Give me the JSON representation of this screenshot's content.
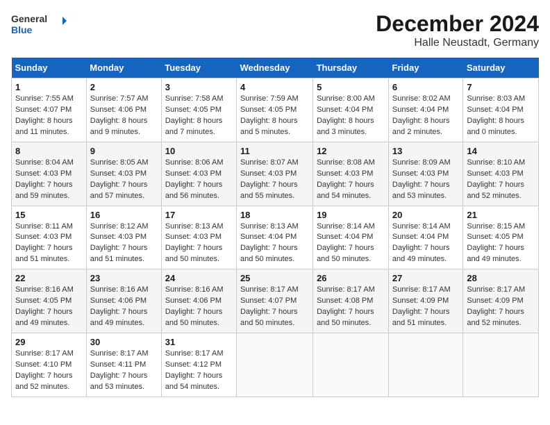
{
  "header": {
    "logo_general": "General",
    "logo_blue": "Blue",
    "month_title": "December 2024",
    "location": "Halle Neustadt, Germany"
  },
  "days_of_week": [
    "Sunday",
    "Monday",
    "Tuesday",
    "Wednesday",
    "Thursday",
    "Friday",
    "Saturday"
  ],
  "weeks": [
    [
      {
        "day": "1",
        "sunrise": "Sunrise: 7:55 AM",
        "sunset": "Sunset: 4:07 PM",
        "daylight": "Daylight: 8 hours and 11 minutes."
      },
      {
        "day": "2",
        "sunrise": "Sunrise: 7:57 AM",
        "sunset": "Sunset: 4:06 PM",
        "daylight": "Daylight: 8 hours and 9 minutes."
      },
      {
        "day": "3",
        "sunrise": "Sunrise: 7:58 AM",
        "sunset": "Sunset: 4:05 PM",
        "daylight": "Daylight: 8 hours and 7 minutes."
      },
      {
        "day": "4",
        "sunrise": "Sunrise: 7:59 AM",
        "sunset": "Sunset: 4:05 PM",
        "daylight": "Daylight: 8 hours and 5 minutes."
      },
      {
        "day": "5",
        "sunrise": "Sunrise: 8:00 AM",
        "sunset": "Sunset: 4:04 PM",
        "daylight": "Daylight: 8 hours and 3 minutes."
      },
      {
        "day": "6",
        "sunrise": "Sunrise: 8:02 AM",
        "sunset": "Sunset: 4:04 PM",
        "daylight": "Daylight: 8 hours and 2 minutes."
      },
      {
        "day": "7",
        "sunrise": "Sunrise: 8:03 AM",
        "sunset": "Sunset: 4:04 PM",
        "daylight": "Daylight: 8 hours and 0 minutes."
      }
    ],
    [
      {
        "day": "8",
        "sunrise": "Sunrise: 8:04 AM",
        "sunset": "Sunset: 4:03 PM",
        "daylight": "Daylight: 7 hours and 59 minutes."
      },
      {
        "day": "9",
        "sunrise": "Sunrise: 8:05 AM",
        "sunset": "Sunset: 4:03 PM",
        "daylight": "Daylight: 7 hours and 57 minutes."
      },
      {
        "day": "10",
        "sunrise": "Sunrise: 8:06 AM",
        "sunset": "Sunset: 4:03 PM",
        "daylight": "Daylight: 7 hours and 56 minutes."
      },
      {
        "day": "11",
        "sunrise": "Sunrise: 8:07 AM",
        "sunset": "Sunset: 4:03 PM",
        "daylight": "Daylight: 7 hours and 55 minutes."
      },
      {
        "day": "12",
        "sunrise": "Sunrise: 8:08 AM",
        "sunset": "Sunset: 4:03 PM",
        "daylight": "Daylight: 7 hours and 54 minutes."
      },
      {
        "day": "13",
        "sunrise": "Sunrise: 8:09 AM",
        "sunset": "Sunset: 4:03 PM",
        "daylight": "Daylight: 7 hours and 53 minutes."
      },
      {
        "day": "14",
        "sunrise": "Sunrise: 8:10 AM",
        "sunset": "Sunset: 4:03 PM",
        "daylight": "Daylight: 7 hours and 52 minutes."
      }
    ],
    [
      {
        "day": "15",
        "sunrise": "Sunrise: 8:11 AM",
        "sunset": "Sunset: 4:03 PM",
        "daylight": "Daylight: 7 hours and 51 minutes."
      },
      {
        "day": "16",
        "sunrise": "Sunrise: 8:12 AM",
        "sunset": "Sunset: 4:03 PM",
        "daylight": "Daylight: 7 hours and 51 minutes."
      },
      {
        "day": "17",
        "sunrise": "Sunrise: 8:13 AM",
        "sunset": "Sunset: 4:03 PM",
        "daylight": "Daylight: 7 hours and 50 minutes."
      },
      {
        "day": "18",
        "sunrise": "Sunrise: 8:13 AM",
        "sunset": "Sunset: 4:04 PM",
        "daylight": "Daylight: 7 hours and 50 minutes."
      },
      {
        "day": "19",
        "sunrise": "Sunrise: 8:14 AM",
        "sunset": "Sunset: 4:04 PM",
        "daylight": "Daylight: 7 hours and 50 minutes."
      },
      {
        "day": "20",
        "sunrise": "Sunrise: 8:14 AM",
        "sunset": "Sunset: 4:04 PM",
        "daylight": "Daylight: 7 hours and 49 minutes."
      },
      {
        "day": "21",
        "sunrise": "Sunrise: 8:15 AM",
        "sunset": "Sunset: 4:05 PM",
        "daylight": "Daylight: 7 hours and 49 minutes."
      }
    ],
    [
      {
        "day": "22",
        "sunrise": "Sunrise: 8:16 AM",
        "sunset": "Sunset: 4:05 PM",
        "daylight": "Daylight: 7 hours and 49 minutes."
      },
      {
        "day": "23",
        "sunrise": "Sunrise: 8:16 AM",
        "sunset": "Sunset: 4:06 PM",
        "daylight": "Daylight: 7 hours and 49 minutes."
      },
      {
        "day": "24",
        "sunrise": "Sunrise: 8:16 AM",
        "sunset": "Sunset: 4:06 PM",
        "daylight": "Daylight: 7 hours and 50 minutes."
      },
      {
        "day": "25",
        "sunrise": "Sunrise: 8:17 AM",
        "sunset": "Sunset: 4:07 PM",
        "daylight": "Daylight: 7 hours and 50 minutes."
      },
      {
        "day": "26",
        "sunrise": "Sunrise: 8:17 AM",
        "sunset": "Sunset: 4:08 PM",
        "daylight": "Daylight: 7 hours and 50 minutes."
      },
      {
        "day": "27",
        "sunrise": "Sunrise: 8:17 AM",
        "sunset": "Sunset: 4:09 PM",
        "daylight": "Daylight: 7 hours and 51 minutes."
      },
      {
        "day": "28",
        "sunrise": "Sunrise: 8:17 AM",
        "sunset": "Sunset: 4:09 PM",
        "daylight": "Daylight: 7 hours and 52 minutes."
      }
    ],
    [
      {
        "day": "29",
        "sunrise": "Sunrise: 8:17 AM",
        "sunset": "Sunset: 4:10 PM",
        "daylight": "Daylight: 7 hours and 52 minutes."
      },
      {
        "day": "30",
        "sunrise": "Sunrise: 8:17 AM",
        "sunset": "Sunset: 4:11 PM",
        "daylight": "Daylight: 7 hours and 53 minutes."
      },
      {
        "day": "31",
        "sunrise": "Sunrise: 8:17 AM",
        "sunset": "Sunset: 4:12 PM",
        "daylight": "Daylight: 7 hours and 54 minutes."
      },
      null,
      null,
      null,
      null
    ]
  ]
}
